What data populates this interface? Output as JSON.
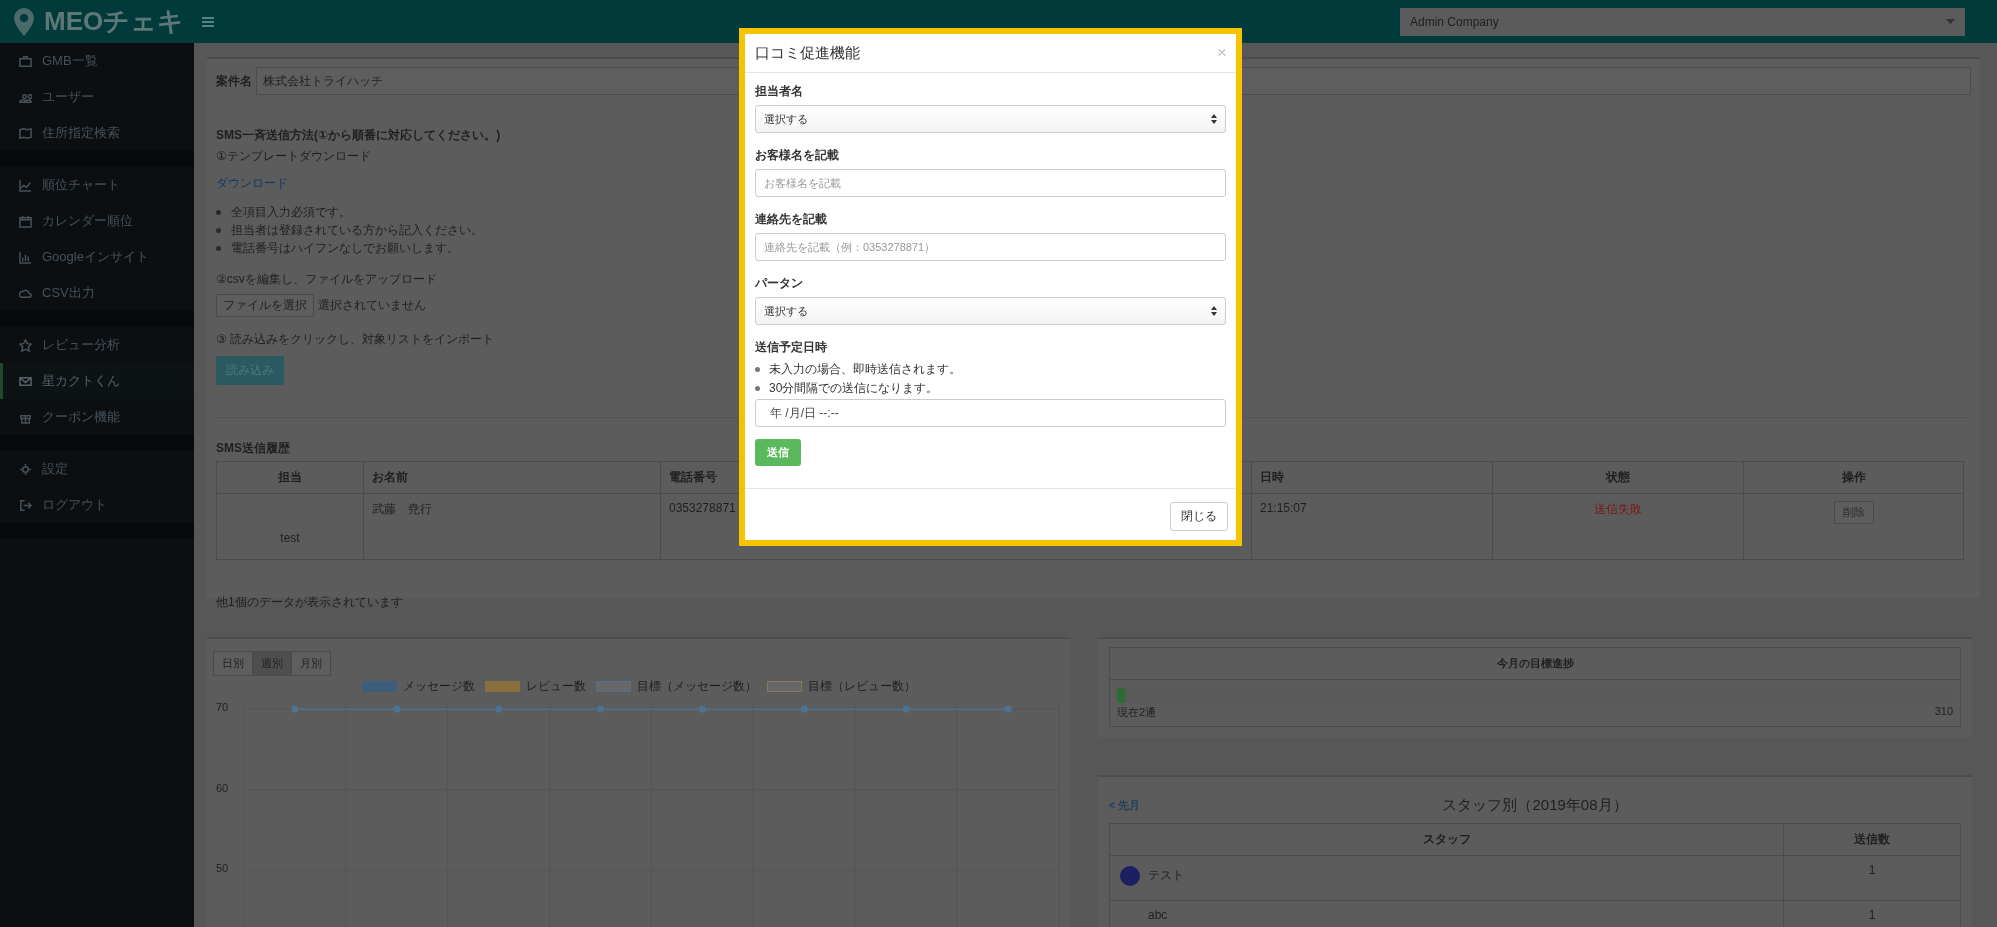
{
  "header": {
    "logo": "MEOチェキ",
    "company_select": "Admin Company"
  },
  "sidebar": {
    "groups": [
      {
        "items": [
          {
            "label": "GMB一覧",
            "selected": false
          },
          {
            "label": "ユーザー",
            "selected": false
          },
          {
            "label": "住所指定検索",
            "selected": false
          }
        ]
      },
      {
        "items": [
          {
            "label": "順位チャート",
            "selected": false
          },
          {
            "label": "カレンダー順位",
            "selected": false
          },
          {
            "label": "Googleインサイト",
            "selected": false
          },
          {
            "label": "CSV出力",
            "selected": false
          }
        ]
      },
      {
        "items": [
          {
            "label": "レビュー分析",
            "selected": false
          },
          {
            "label": "星カクトくん",
            "selected": true
          },
          {
            "label": "クーポン機能",
            "selected": false
          }
        ]
      },
      {
        "items": [
          {
            "label": "設定",
            "selected": false
          },
          {
            "label": "ログアウト",
            "selected": false
          }
        ]
      }
    ]
  },
  "sms_panel": {
    "case_label": "案件名",
    "case_value": "株式会社トライハッチ",
    "method_heading": "SMS一斉送信方法(①から順番に対応してください。)",
    "step1": "①テンプレートダウンロード",
    "download_link": "ダウンロード",
    "notes": [
      "全項目入力必須です。",
      "担当者は登録されている方から記入ください。",
      "電話番号はハイフンなしでお願いします。"
    ],
    "step2": "②csvを編集し、ファイルをアップロード",
    "file_button": "ファイルを選択",
    "file_status": "選択されていません",
    "step3": "③ 読み込みをクリックし、対象リストをインポート",
    "import_button": "読み込み",
    "history_heading": "SMS送信履歴",
    "table": {
      "columns": [
        "担当",
        "お名前",
        "電話番号",
        "日時",
        "状態",
        "操作"
      ],
      "rows": [
        {
          "staff": "test",
          "name": "武藤　尭行",
          "phone": "0353278871",
          "datetime": "21:15:07",
          "status": "送信失敗",
          "failed": true,
          "action": "削除"
        }
      ]
    },
    "footer": "他1個のデータが表示されています"
  },
  "chart_panel": {
    "tabs": [
      {
        "label": "日別",
        "selected": false
      },
      {
        "label": "週別",
        "selected": true
      },
      {
        "label": "月別",
        "selected": false
      }
    ],
    "legend": [
      {
        "label": "メッセージ数",
        "kind": "filled",
        "color": "#3d5e7a"
      },
      {
        "label": "レビュー数",
        "kind": "filled",
        "color": "#8a6f3e"
      },
      {
        "from_chart": true,
        "kind": "outline"
      },
      {
        "label": "目標（レビュー数）",
        "kind": "outline",
        "color": "#8a7a5a"
      }
    ],
    "chart_data": {
      "type": "line",
      "ylim": [
        40,
        71
      ],
      "yticks": [
        50,
        60,
        70
      ],
      "series": [
        {
          "name": "目標（メッセージ数）",
          "color": "#4d7394",
          "marker": "circle",
          "values": [
            70,
            70,
            70,
            70,
            70,
            70,
            70,
            70
          ]
        }
      ]
    }
  },
  "goal_panel": {
    "title": "今月の目標進捗",
    "level": 0.01,
    "current": "現在2通",
    "target": "310"
  },
  "staff_panel": {
    "prev_link": "< 先月",
    "title": "スタッフ別（2019年08月）",
    "columns": [
      "スタッフ",
      "送信数"
    ],
    "rows": [
      {
        "name": "テスト",
        "avatar": true,
        "count": "1"
      },
      {
        "name": "abc",
        "avatar": false,
        "count": "1"
      }
    ]
  },
  "modal": {
    "title": "口コミ促進機能",
    "close": "×",
    "fields": [
      {
        "kind": "select",
        "label": "担当者名",
        "value": "選択する"
      },
      {
        "kind": "text",
        "label": "お客様名を記載",
        "placeholder": "お客様名を記載"
      },
      {
        "kind": "text",
        "label": "連絡先を記載",
        "placeholder": "連絡先を記載（例：0353278871）"
      },
      {
        "kind": "select",
        "label": "パータン",
        "value": "選択する"
      },
      {
        "kind": "datetime",
        "label": "送信予定日時",
        "notes": [
          "未入力の場合、即時送信されます。",
          "30分間隔での送信になります。"
        ],
        "value": "年 /月/日 --:--"
      }
    ],
    "submit_button": "送信",
    "close_button": "閉じる"
  }
}
